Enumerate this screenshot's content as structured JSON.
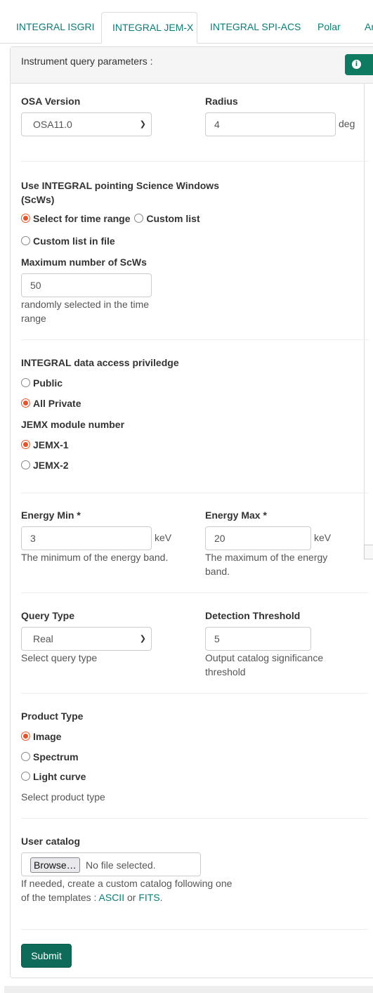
{
  "tabs": [
    "INTEGRAL ISGRI",
    "INTEGRAL JEM-X",
    "INTEGRAL SPI-ACS",
    "Polar",
    "An"
  ],
  "active_tab": "INTEGRAL JEM-X",
  "panel": {
    "title": "Instrument query parameters :",
    "info_icon": "info-circle-icon"
  },
  "osa": {
    "label": "OSA Version",
    "value": "OSA11.0"
  },
  "radius": {
    "label": "Radius",
    "value": "4",
    "unit": "deg"
  },
  "scw": {
    "label_line1": "Use INTEGRAL pointing Science Windows",
    "label_line2": "(ScWs)",
    "options": [
      "Select for time range",
      "Custom list",
      "Custom list in file"
    ],
    "selected": "Select for time range"
  },
  "max_scw": {
    "label": "Maximum number of ScWs",
    "value": "50",
    "help_line1": "randomly selected in the time",
    "help_line2": "range"
  },
  "privilege": {
    "label": "INTEGRAL data access priviledge",
    "options": [
      "Public",
      "All Private"
    ],
    "selected": "All Private"
  },
  "jemx": {
    "label": "JEMX module number",
    "options": [
      "JEMX-1",
      "JEMX-2"
    ],
    "selected": "JEMX-1"
  },
  "energy_min": {
    "label": "Energy Min *",
    "value": "3",
    "unit": "keV",
    "help": "The minimum of the energy band."
  },
  "energy_max": {
    "label": "Energy Max *",
    "value": "20",
    "unit": "keV",
    "help_line1": "The maximum of the energy",
    "help_line2": "band."
  },
  "query_type": {
    "label": "Query Type",
    "value": "Real",
    "help": "Select query type"
  },
  "detection": {
    "label": "Detection Threshold",
    "value": "5",
    "help_line1": "Output catalog significance",
    "help_line2": "threshold"
  },
  "product_type": {
    "label": "Product Type",
    "options": [
      "Image",
      "Spectrum",
      "Light curve"
    ],
    "selected": "Image",
    "help": "Select product type"
  },
  "catalog": {
    "label": "User catalog",
    "browse": "Browse…",
    "no_file": "No file selected.",
    "help_line1": "If needed, create a custom catalog following one",
    "help_line2_prefix": "of the templates : ",
    "link_ascii": "ASCII",
    "or": " or ",
    "link_fits": "FITS",
    "period": "."
  },
  "submit_label": "Submit",
  "colors": {
    "accent": "#0e7a75",
    "radio": "#e0562a",
    "button": "#0e6b5a"
  }
}
